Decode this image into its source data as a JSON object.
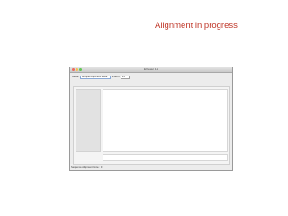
{
  "slide": {
    "title": "Alignment in progress",
    "title_color": "#c0392b"
  },
  "window": {
    "title": "EViewer 1.1",
    "toolbar": {
      "mode_label": "Mode",
      "mode_value": "Multiple Alignment Mode",
      "zoom_label": "Zoom",
      "zoom_value": "25"
    },
    "status_text": "Sequence Alignment Done : 0"
  }
}
